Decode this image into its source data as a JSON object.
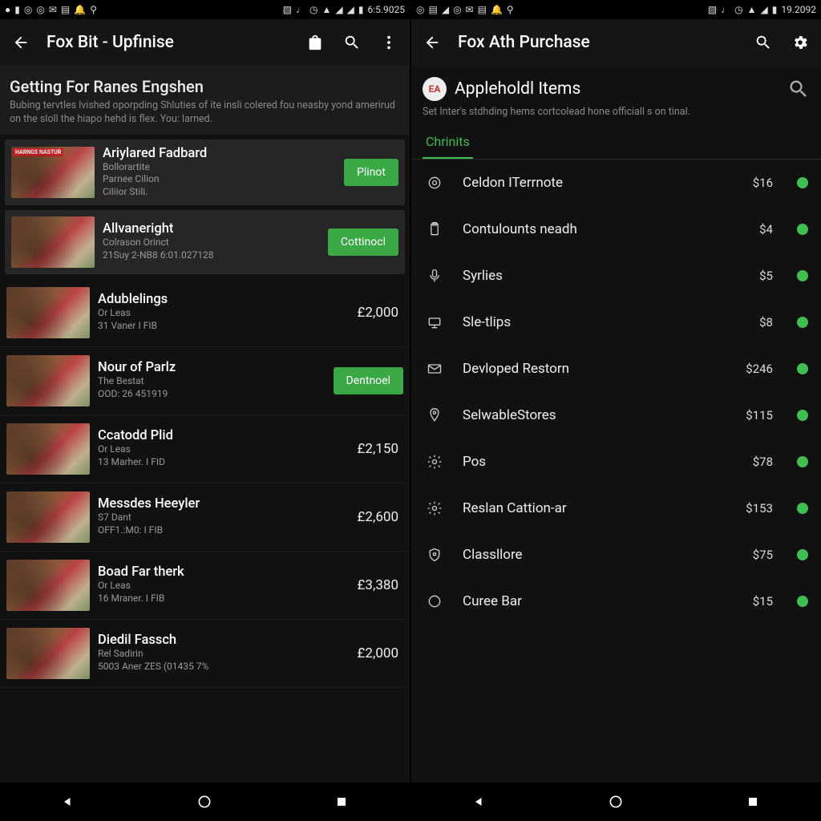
{
  "left": {
    "status_time": "6:5.9025",
    "app_title": "Fox Bit - Upfinise",
    "section_title": "Getting For Ranes Engshen",
    "section_desc": "Bubing tervtles lvished oporpding Shluties of ite insli colered fou neasby yond amerirud on the sloll the hiapo hehd is flex. You: larned.",
    "featured": [
      {
        "title": "Ariylared Fadbard",
        "sub1": "Bollorartite",
        "sub2": "Parnee Cilion",
        "sub3": "Ciliior Stili.",
        "btn": "Plinot",
        "badge": "HARNGS NASTUR"
      },
      {
        "title": "Allvaneright",
        "sub1": "Colrason Orinct",
        "sub2": "21Suy 2-NB8 6:01.027128",
        "btn": "Cottinocl",
        "badge": ""
      }
    ],
    "items": [
      {
        "title": "Adublelings",
        "sub1": "Or Leas",
        "sub2": "31 Vaner I FIB",
        "price": "£2,000"
      },
      {
        "title": "Nour of Parlz",
        "sub1": "The Bestat",
        "sub2": "OOD: 26 451919",
        "btn": "Dentnoel"
      },
      {
        "title": "Ccatodd Plid",
        "sub1": "Or Leas",
        "sub2": "13 Marher. I FID",
        "price": "£2,150"
      },
      {
        "title": "Messdes Heeyler",
        "sub1": "S7 Dant",
        "sub2": "OFF1.:M0: I FIB",
        "price": "£2,600"
      },
      {
        "title": "Boad Far therk",
        "sub1": "Or Leas",
        "sub2": "16 Mraner. I FIB",
        "price": "£3,380"
      },
      {
        "title": "Diedil Fassch",
        "sub1": "Rel Sadirin",
        "sub2": "5003 Aner ZES (01435 7%",
        "price": "£2,000"
      }
    ]
  },
  "right": {
    "status_time": "19.2092",
    "app_title": "Fox Ath Purchase",
    "sub_title": "Appleholdl Items",
    "sub_desc": "Set Inter's stdhding hems cortcolead hone officiall s on tinal.",
    "tab": "Chrinits",
    "items": [
      {
        "icon": "target",
        "label": "Celdon ITerrnote",
        "price": "$16"
      },
      {
        "icon": "clipboard",
        "label": "Contulounts neadh",
        "price": "$4"
      },
      {
        "icon": "mic",
        "label": "Syrlies",
        "price": "$5"
      },
      {
        "icon": "monitor",
        "label": "Sle-tlips",
        "price": "$8"
      },
      {
        "icon": "mail",
        "label": "Devloped Restorn",
        "price": "$246"
      },
      {
        "icon": "pin",
        "label": "SelwableStores",
        "price": "$115"
      },
      {
        "icon": "gear",
        "label": "Pos",
        "price": "$78"
      },
      {
        "icon": "gear",
        "label": "Reslan Cattion-ar",
        "price": "$153"
      },
      {
        "icon": "shield",
        "label": "Classllore",
        "price": "$75"
      },
      {
        "icon": "circle",
        "label": "Curee Bar",
        "price": "$15"
      }
    ]
  }
}
